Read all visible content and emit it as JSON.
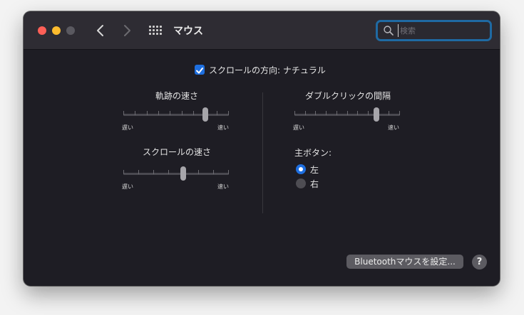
{
  "window": {
    "title": "マウス",
    "traffic_lights": {
      "close": "#fe5f57",
      "minimize": "#febc2e",
      "zoom": "#5a5960"
    }
  },
  "toolbar": {
    "back_icon": "chevron-left-icon",
    "forward_icon": "chevron-right-icon",
    "show_all_icon": "grid-icon",
    "search": {
      "placeholder": "検索",
      "value": "",
      "icon": "magnifier-icon"
    }
  },
  "scroll_direction": {
    "label": "スクロールの方向: ナチュラル",
    "checked": true
  },
  "tracking_speed": {
    "label": "軌跡の速さ",
    "min_label": "遅い",
    "max_label": "速い",
    "ticks": 10,
    "level": 0.78
  },
  "double_click": {
    "label": "ダブルクリックの間隔",
    "min_label": "遅い",
    "max_label": "速い",
    "ticks": 11,
    "level": 0.78
  },
  "scroll_speed": {
    "label": "スクロールの速さ",
    "min_label": "遅い",
    "max_label": "速い",
    "ticks": 8,
    "level": 0.57
  },
  "primary_button": {
    "label": "主ボタン:",
    "options": [
      {
        "label": "左",
        "selected": true
      },
      {
        "label": "右",
        "selected": false
      }
    ]
  },
  "footer": {
    "bluetooth_button": "Bluetoothマウスを設定...",
    "help": "?"
  },
  "colors": {
    "accent": "#1e6fe0",
    "window_bg": "#1e1d24",
    "titlebar_bg": "#2e2c33"
  }
}
